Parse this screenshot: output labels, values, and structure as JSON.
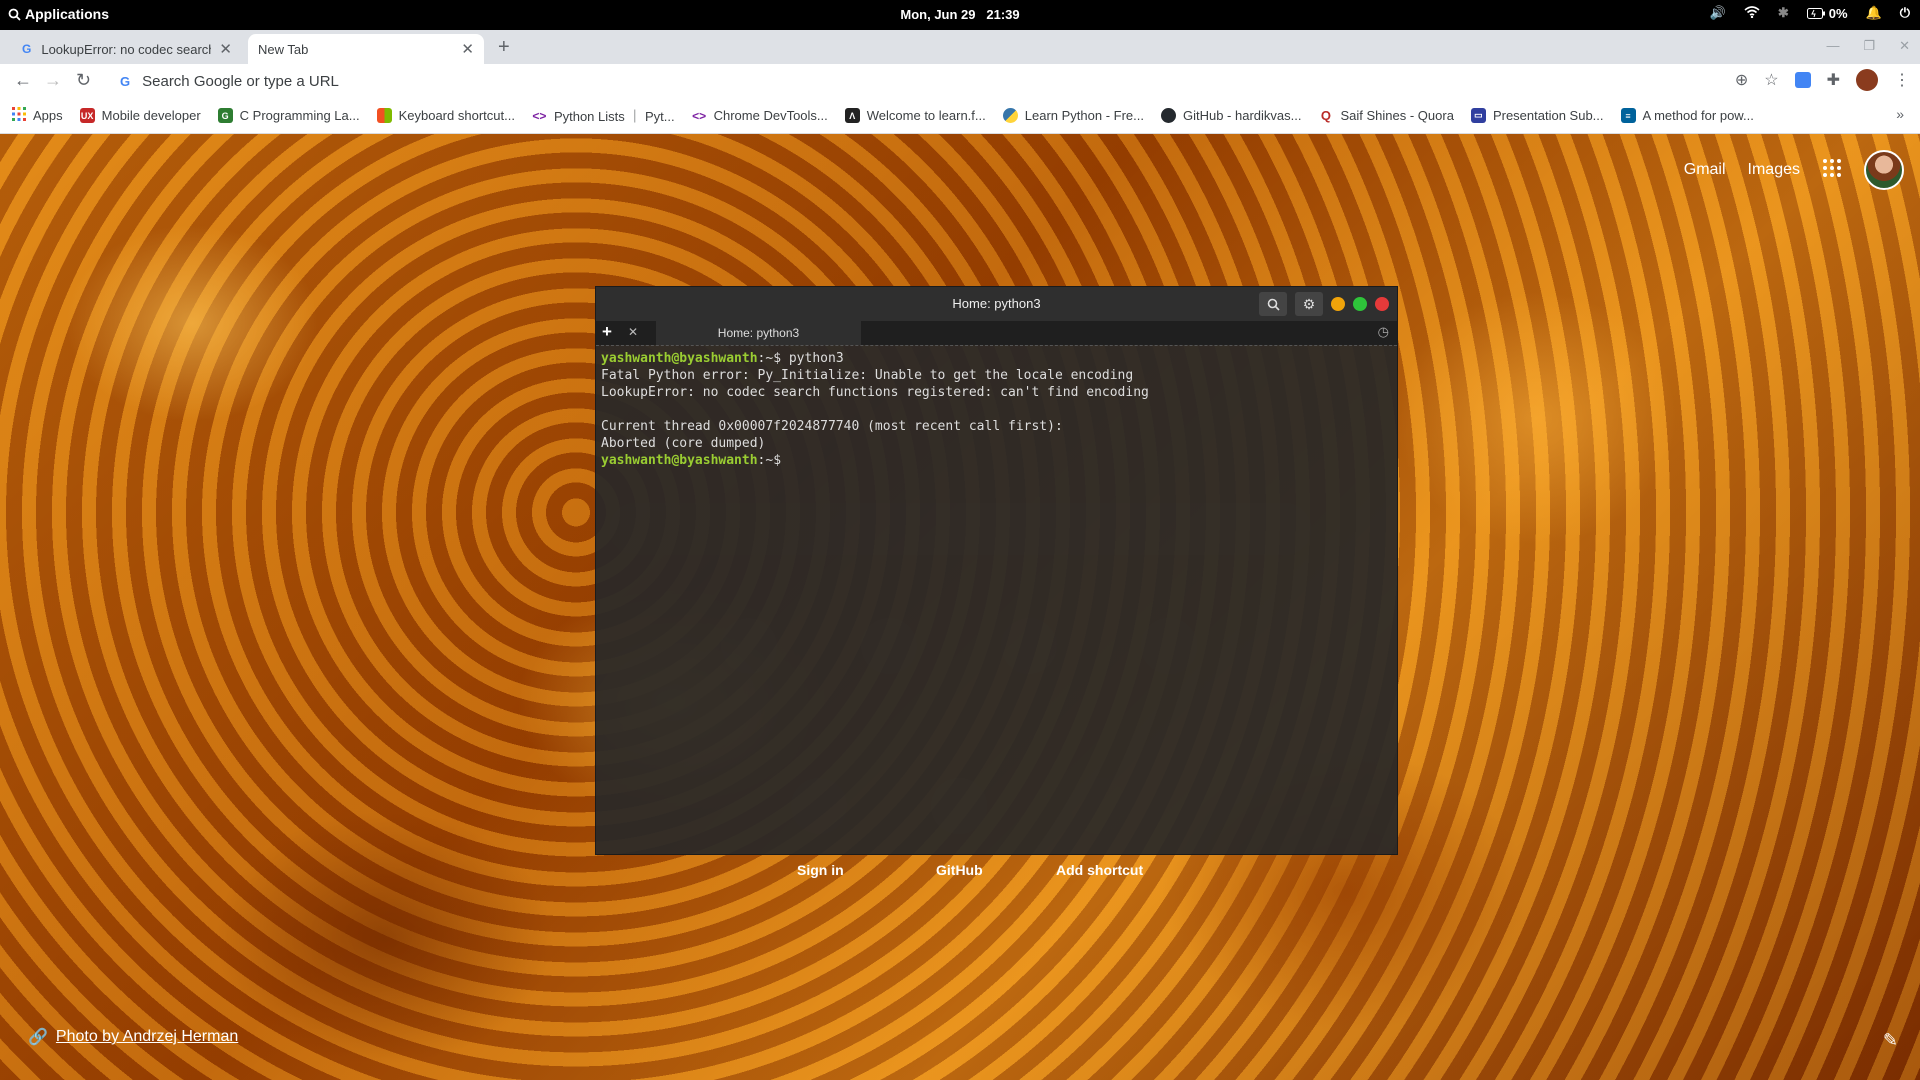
{
  "topbar": {
    "applications": "Applications",
    "date": "Mon, Jun 29",
    "time": "21:39",
    "battery": "0%"
  },
  "tabs": [
    {
      "title": "LookupError: no codec search f",
      "active": false
    },
    {
      "title": "New Tab",
      "active": true
    }
  ],
  "omnibox": {
    "placeholder": "Search Google or type a URL"
  },
  "bookmarks": [
    {
      "label": "Apps",
      "icon": "apps-grid-icon",
      "color": "#ea4335"
    },
    {
      "label": "Mobile developer",
      "icon": "ux-icon",
      "color": "#c62828"
    },
    {
      "label": "C Programming La...",
      "icon": "sg-icon",
      "color": "#2e7d32"
    },
    {
      "label": "Keyboard shortcut...",
      "icon": "microsoft-icon",
      "color": "#f25022"
    },
    {
      "label": "Python Lists ｜ Pyt...",
      "icon": "code-icon",
      "color": "#7b1fa2"
    },
    {
      "label": "Chrome DevTools...",
      "icon": "code-icon",
      "color": "#7b1fa2"
    },
    {
      "label": "Welcome to learn.f...",
      "icon": "learn-icon",
      "color": "#222222"
    },
    {
      "label": "Learn Python - Fre...",
      "icon": "python-icon",
      "color": "#3776ab"
    },
    {
      "label": "GitHub - hardikvas...",
      "icon": "github-icon",
      "color": "#24292e"
    },
    {
      "label": "Saif Shines - Quora",
      "icon": "quora-icon",
      "color": "#b92b27"
    },
    {
      "label": "Presentation Sub...",
      "icon": "presentation-icon",
      "color": "#303f9f"
    },
    {
      "label": "A method for pow...",
      "icon": "ieee-icon",
      "color": "#00629b"
    }
  ],
  "google": {
    "gmail": "Gmail",
    "images": "Images"
  },
  "terminal": {
    "title": "Home: python3",
    "tab_label": "Home: python3",
    "prompt_user": "yashwanth@byashwanth",
    "prompt_suffix": ":~$",
    "command": " python3",
    "output": [
      "Fatal Python error: Py_Initialize: Unable to get the locale encoding",
      "LookupError: no codec search functions registered: can't find encoding",
      "",
      "Current thread 0x00007f2024877740 (most recent call first):",
      "Aborted (core dumped)"
    ]
  },
  "shortcuts": {
    "sign_in": "Sign in",
    "github": "GitHub",
    "add": "Add shortcut"
  },
  "photo_credit": "Photo by Andrzej Herman"
}
